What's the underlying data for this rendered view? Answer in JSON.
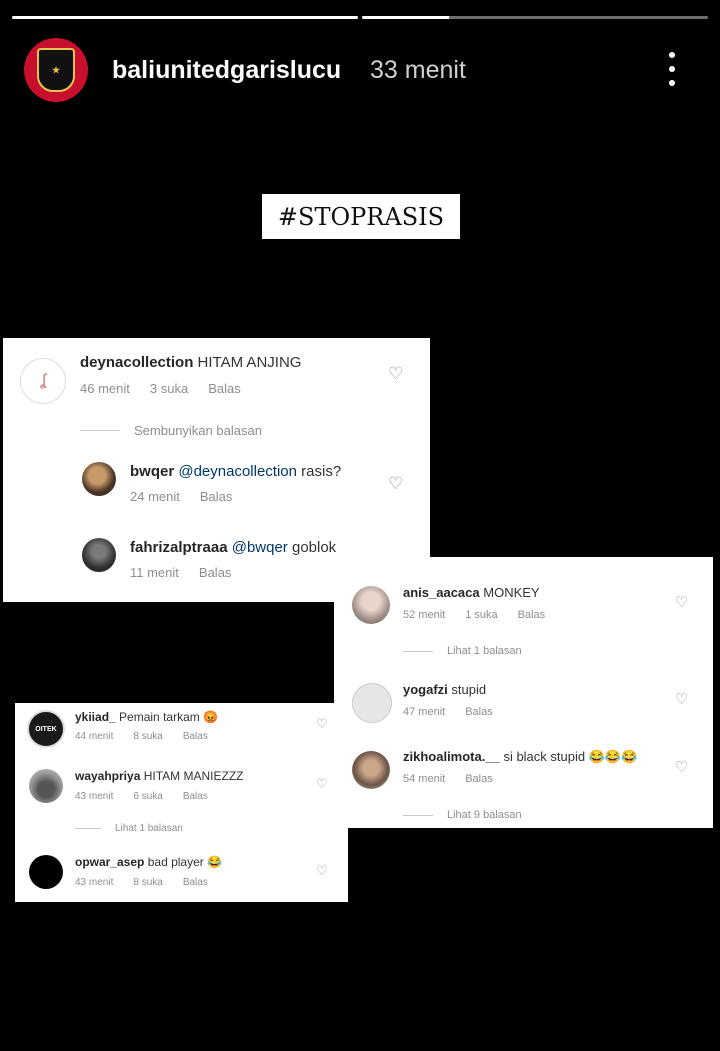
{
  "story": {
    "progress": [
      1.0,
      0.25
    ],
    "username": "baliunitedgarislucu",
    "time": "33 menit",
    "more_icon": "more-vertical-icon",
    "hashtag": "#STOPRASIS"
  },
  "card1": {
    "c1": {
      "user": "deynacollection",
      "text": "HITAM ANJING",
      "time": "46 menit",
      "likes": "3 suka",
      "reply": "Balas"
    },
    "hide_replies": "Sembunyikan balasan",
    "c2": {
      "user": "bwqer",
      "mention": "@deynacollection",
      "text": "rasis?",
      "time": "24 menit",
      "reply": "Balas"
    },
    "c3": {
      "user": "fahrizalptraaa",
      "mention": "@bwqer",
      "text": "goblok",
      "time": "11 menit",
      "reply": "Balas"
    }
  },
  "card2": {
    "c1": {
      "user": "anis_aacaca",
      "text": "MONKEY",
      "time": "52 menit",
      "likes": "1 suka",
      "reply": "Balas"
    },
    "view1": "Lihat 1 balasan",
    "c2": {
      "user": "yogafzi",
      "text": "stupid",
      "time": "47 menit",
      "reply": "Balas"
    },
    "c3": {
      "user": "zikhoalimota.__",
      "text": "si black stupid 😂😂😂",
      "time": "54 menit",
      "reply": "Balas"
    },
    "view2": "Lihat 9 balasan"
  },
  "card3": {
    "c1": {
      "user": "ykiiad_",
      "text": "Pemain tarkam 😡",
      "time": "44 menit",
      "likes": "8 suka",
      "reply": "Balas",
      "avatar_text": "OITEK"
    },
    "c2": {
      "user": "wayahpriya",
      "text": "HITAM MANIEZZZ",
      "time": "43 menit",
      "likes": "6 suka",
      "reply": "Balas"
    },
    "view1": "Lihat 1 balasan",
    "c3": {
      "user": "opwar_asep",
      "text": "bad player 😂",
      "time": "43 menit",
      "likes": "8 suka",
      "reply": "Balas"
    }
  },
  "colors": {
    "brand_red": "#c8102e",
    "ig_link": "#00376b",
    "meta_gray": "#8e8e8e"
  }
}
